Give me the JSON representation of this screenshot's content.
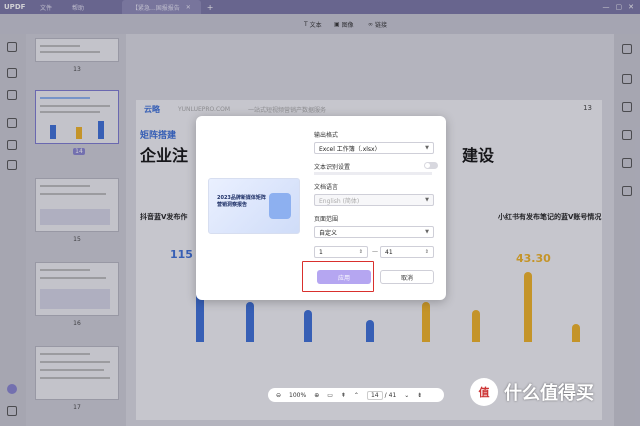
{
  "titlebar": {
    "logo": "UPDF",
    "tabs": [
      {
        "label": "文件"
      },
      {
        "label": "帮助"
      },
      {
        "label": "【紧急...国报报告",
        "active": true
      }
    ],
    "window_controls": [
      "—",
      "▢",
      "✕"
    ]
  },
  "toolbar": {
    "text_label": "文本",
    "image_label": "图像",
    "link_label": "链接"
  },
  "thumbnails": {
    "page_numbers": [
      "13",
      "14",
      "15",
      "16",
      "17"
    ],
    "selected": "14"
  },
  "document": {
    "page_number": "13",
    "brand": "云略",
    "domain": "YUNLUEPRO.COM",
    "tagline": "一站式短视频营销产数据服务",
    "section": "矩阵搭建",
    "heading_left": "企业注",
    "heading_right": "建设",
    "left_label": "抖音蓝V发布作",
    "right_label": "小红书有发布笔记的蓝V账号情况",
    "left_value": "115",
    "right_value": "43.30"
  },
  "dialog": {
    "output_format_label": "输出格式",
    "output_format_value": "Excel 工作簿（.xlsx）",
    "ocr_label": "文本识别设置",
    "ocr_enabled": false,
    "doc_language_label": "文档语言",
    "doc_language_value": "English (简体)",
    "page_range_label": "页面范围",
    "page_range_value": "自定义",
    "range_from": "1",
    "range_to": "41",
    "range_separator": "—",
    "apply_label": "应用",
    "cancel_label": "取消",
    "cover_title": "2023品牌新媒体矩阵营销洞察报告"
  },
  "pager": {
    "zoom": "100%",
    "current_page": "14",
    "separator": "/",
    "total_pages": "41"
  },
  "watermark": {
    "circle_text": "值",
    "text": "什么值得买"
  },
  "colors": {
    "accent": "#8884d0",
    "apply_button": "#b5a6f1",
    "highlight_box": "#d9302d",
    "bar_blue": "#3b6fd8",
    "bar_orange": "#f0b324"
  }
}
